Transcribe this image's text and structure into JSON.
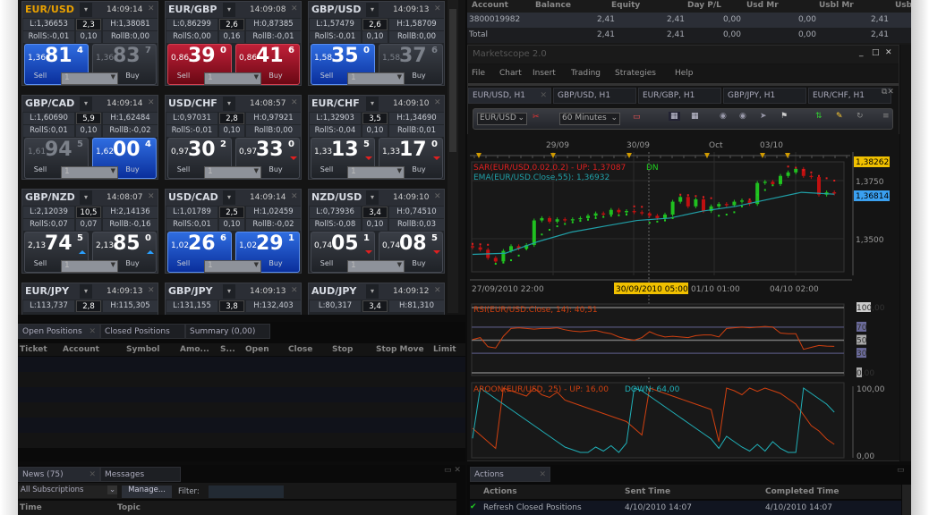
{
  "rates": [
    {
      "pair": "EUR/USD",
      "selected": true,
      "time": "14:09:14",
      "low": "L:1,36653",
      "spread": "2,3",
      "high": "H:1,38081",
      "rolls": "RollS:-0,01",
      "mid": "0,10",
      "rollb": "RollB:0,00",
      "sell": {
        "pre": "1,36",
        "big": "81",
        "pip": "4",
        "state": "blue",
        "arrow": ""
      },
      "buy": {
        "pre": "1,36",
        "big": "83",
        "pip": "7",
        "state": "dim",
        "arrow": ""
      },
      "amount": "1",
      "sell_label": "Sell",
      "buy_label": "Buy"
    },
    {
      "pair": "EUR/GBP",
      "time": "14:09:08",
      "low": "L:0,86299",
      "spread": "2,6",
      "high": "H:0,87385",
      "rolls": "RollS:0,00",
      "mid": "0,16",
      "rollb": "RollB:-0,01",
      "sell": {
        "pre": "0,86",
        "big": "39",
        "pip": "0",
        "state": "red",
        "arrow": ""
      },
      "buy": {
        "pre": "0,86",
        "big": "41",
        "pip": "6",
        "state": "red",
        "arrow": ""
      },
      "amount": "1",
      "sell_label": "Sell",
      "buy_label": "Buy"
    },
    {
      "pair": "GBP/USD",
      "time": "14:09:13",
      "low": "L:1,57479",
      "spread": "2,6",
      "high": "H:1,58709",
      "rolls": "RollS:-0,01",
      "mid": "0,10",
      "rollb": "RollB:0,00",
      "sell": {
        "pre": "1,58",
        "big": "35",
        "pip": "0",
        "state": "blue",
        "arrow": ""
      },
      "buy": {
        "pre": "1,58",
        "big": "37",
        "pip": "6",
        "state": "dim",
        "arrow": ""
      },
      "amount": "1",
      "sell_label": "Sell",
      "buy_label": "Buy"
    },
    {
      "pair": "GBP/CAD",
      "time": "14:09:14",
      "low": "L:1,60690",
      "spread": "5,9",
      "high": "H:1,62484",
      "rolls": "RollS:0,01",
      "mid": "0,10",
      "rollb": "RollB:-0,02",
      "sell": {
        "pre": "1,61",
        "big": "94",
        "pip": "5",
        "state": "dim",
        "arrow": ""
      },
      "buy": {
        "pre": "1,62",
        "big": "00",
        "pip": "4",
        "state": "blue",
        "arrow": ""
      },
      "amount": "1",
      "sell_label": "Sell",
      "buy_label": "Buy"
    },
    {
      "pair": "USD/CHF",
      "time": "14:08:57",
      "low": "L:0,97031",
      "spread": "2,8",
      "high": "H:0,97921",
      "rolls": "RollS:-0,01",
      "mid": "0,10",
      "rollb": "RollB:0,00",
      "sell": {
        "pre": "0,97",
        "big": "30",
        "pip": "2",
        "state": "normal",
        "arrow": ""
      },
      "buy": {
        "pre": "0,97",
        "big": "33",
        "pip": "0",
        "state": "normal",
        "arrow": "down"
      },
      "amount": "1",
      "sell_label": "Sell",
      "buy_label": "Buy"
    },
    {
      "pair": "EUR/CHF",
      "time": "14:09:10",
      "low": "L:1,32903",
      "spread": "3,5",
      "high": "H:1,34690",
      "rolls": "RollS:-0,04",
      "mid": "0,10",
      "rollb": "RollB:0,01",
      "sell": {
        "pre": "1,33",
        "big": "13",
        "pip": "5",
        "state": "normal",
        "arrow": "down"
      },
      "buy": {
        "pre": "1,33",
        "big": "17",
        "pip": "0",
        "state": "normal",
        "arrow": "down"
      },
      "amount": "1",
      "sell_label": "Sell",
      "buy_label": "Buy"
    },
    {
      "pair": "GBP/NZD",
      "time": "14:08:07",
      "low": "L:2,12039",
      "spread": "10,5",
      "high": "H:2,14136",
      "rolls": "RollS:0,07",
      "mid": "0,07",
      "rollb": "RollB:-0,16",
      "sell": {
        "pre": "2,13",
        "big": "74",
        "pip": "5",
        "state": "normal",
        "arrow": "up"
      },
      "buy": {
        "pre": "2,13",
        "big": "85",
        "pip": "0",
        "state": "normal",
        "arrow": "up"
      },
      "amount": "1",
      "sell_label": "Sell",
      "buy_label": "Buy"
    },
    {
      "pair": "USD/CAD",
      "time": "14:09:14",
      "low": "L:1,01789",
      "spread": "2,5",
      "high": "H:1,02459",
      "rolls": "RollS:0,01",
      "mid": "0,10",
      "rollb": "RollB:-0,02",
      "sell": {
        "pre": "1,02",
        "big": "26",
        "pip": "6",
        "state": "blue",
        "arrow": ""
      },
      "buy": {
        "pre": "1,02",
        "big": "29",
        "pip": "1",
        "state": "blue",
        "arrow": ""
      },
      "amount": "1",
      "sell_label": "Sell",
      "buy_label": "Buy"
    },
    {
      "pair": "NZD/USD",
      "time": "14:09:10",
      "low": "L:0,73936",
      "spread": "3,4",
      "high": "H:0,74510",
      "rolls": "RollS:-0,08",
      "mid": "0,10",
      "rollb": "RollB:0,03",
      "sell": {
        "pre": "0,74",
        "big": "05",
        "pip": "1",
        "state": "normal",
        "arrow": "down"
      },
      "buy": {
        "pre": "0,74",
        "big": "08",
        "pip": "5",
        "state": "normal",
        "arrow": "down"
      },
      "amount": "1",
      "sell_label": "Sell",
      "buy_label": "Buy"
    },
    {
      "pair": "EUR/JPY",
      "time": "14:09:13",
      "low": "L:113,737",
      "spread": "2,8",
      "high": "H:115,305"
    },
    {
      "pair": "GBP/JPY",
      "time": "14:09:13",
      "low": "L:131,155",
      "spread": "3,8",
      "high": "H:132,403"
    },
    {
      "pair": "AUD/JPY",
      "time": "14:09:12",
      "low": "L:80,317",
      "spread": "3,4",
      "high": "H:81,310"
    }
  ],
  "accounts": {
    "headers": [
      "Account",
      "Balance",
      "Equity",
      "Day P/L",
      "Usd Mr",
      "Usbl Mr",
      "Usb"
    ],
    "rows": [
      [
        "3800019982",
        "2,41",
        "2,41",
        "0,00",
        "0,00",
        "2,41"
      ],
      [
        "Total",
        "2,41",
        "2,41",
        "0,00",
        "0,00",
        "2,41"
      ]
    ]
  },
  "marketscope": {
    "title": "Marketscope 2.0",
    "menu": [
      "File",
      "Chart",
      "Insert",
      "Trading",
      "Strategies",
      "Help"
    ],
    "tabs": [
      "EUR/USD, H1",
      "GBP/USD, H1",
      "EUR/GBP, H1",
      "GBP/JPY, H1",
      "EUR/CHF, H1"
    ],
    "symbol": "EUR/USD",
    "timeframe": "60 Minutes",
    "sar_label": "SAR(EUR/USD,0.02,0.2) -  UP: 1,37087",
    "sar_dn": "DN",
    "ema_label": "EMA(EUR/USD.Close,55): 1,36932",
    "rsi_label": "RSI(EUR/USD.Close, 14): 40,51",
    "aroon_label": "AROON(EUR/USD, 25) -  UP: 16,00",
    "aroon_down": "DOWN: 64,00",
    "top_dates": [
      "29/09",
      "30/09",
      "Oct",
      "03/10"
    ],
    "bottom_dates": [
      "27/09/2010 22:00",
      "30/09/2010 05:00",
      "01/10 01:00",
      "04/10 02:00"
    ],
    "price_labels": [
      "1,3750",
      "1,3500"
    ],
    "high_marker": "1,38262",
    "current_marker": "1,36814",
    "rsi_axis": [
      "100,00",
      "70",
      "50",
      "30",
      "0,00"
    ],
    "aroon_axis": [
      "100,00",
      "0,00"
    ],
    "colors": {
      "up": "#20c020",
      "down": "#c01010",
      "ema": "#20a0a8",
      "sar_up": "#e02020",
      "sar_dn": "#20d020",
      "rsi": "#d04010",
      "aroon_up": "#d04010",
      "aroon_down": "#20b0b8",
      "marker_high": "#f0c000",
      "marker_current": "#3aa0f0"
    }
  },
  "chart_data": {
    "type": "line",
    "close": [
      1.3465,
      1.3455,
      1.342,
      1.3405,
      1.345,
      1.347,
      1.346,
      1.3475,
      1.358,
      1.359,
      1.3575,
      1.3585,
      1.358,
      1.3585,
      1.359,
      1.36,
      1.361,
      1.3605,
      1.3625,
      1.3615,
      1.362,
      1.3615,
      1.361,
      1.36,
      1.359,
      1.3605,
      1.366,
      1.368,
      1.364,
      1.367,
      1.362,
      1.364,
      1.365,
      1.3645,
      1.366,
      1.3665,
      1.365,
      1.374,
      1.3745,
      1.3735,
      1.377,
      1.3785,
      1.38,
      1.377,
      1.3765,
      1.369,
      1.37,
      1.3695
    ],
    "ema": [
      1.3435,
      1.344,
      1.349,
      1.353,
      1.3555,
      1.358,
      1.359,
      1.362,
      1.364,
      1.367,
      1.37,
      1.3692
    ],
    "sar": [
      1.348,
      1.3478,
      1.3476,
      1.3395,
      1.34,
      1.341,
      1.343,
      1.346,
      1.349,
      1.352,
      1.354,
      1.3555,
      1.3565,
      1.3572,
      1.3578,
      1.3583,
      1.359,
      1.3595,
      1.36,
      1.3602,
      1.3605,
      1.364,
      1.3638,
      1.357,
      1.3575,
      1.358,
      1.359,
      1.369,
      1.3688,
      1.3684,
      1.368,
      1.3675,
      1.36,
      1.3605,
      1.3615,
      1.364,
      1.367,
      1.369,
      1.371,
      1.373,
      1.3745,
      1.381,
      1.3805,
      1.3795,
      1.3785,
      1.377,
      1.376,
      1.375
    ],
    "rsi": [
      51,
      54,
      40,
      38,
      56,
      68,
      69,
      68,
      67,
      68,
      68,
      69,
      66,
      64,
      63,
      64,
      65,
      62,
      60,
      55,
      52,
      50,
      54,
      63,
      58,
      55,
      56,
      55,
      54,
      57,
      58,
      58,
      55,
      68,
      69,
      70,
      69,
      70,
      71,
      70,
      61,
      60,
      60,
      36,
      39,
      42,
      41,
      40.51
    ],
    "aroon_up": [
      40,
      30,
      20,
      10,
      100,
      96,
      92,
      88,
      100,
      90,
      86,
      94,
      82,
      78,
      74,
      70,
      66,
      62,
      58,
      54,
      50,
      40,
      30,
      100,
      96,
      92,
      88,
      84,
      80,
      76,
      72,
      68,
      20,
      100,
      96,
      90,
      100,
      95,
      100,
      96,
      92,
      84,
      76,
      60,
      44,
      36,
      24,
      16
    ],
    "aroon_down": [
      25,
      100,
      92,
      84,
      76,
      68,
      60,
      52,
      44,
      36,
      28,
      20,
      12,
      8,
      4,
      4,
      12,
      6,
      14,
      4,
      18,
      100,
      96,
      88,
      80,
      72,
      64,
      56,
      48,
      40,
      32,
      24,
      10,
      28,
      20,
      12,
      6,
      16,
      6,
      20,
      10,
      4,
      4,
      100,
      92,
      84,
      76,
      64
    ],
    "ylim": [
      1.3371,
      1.3833
    ]
  },
  "positions": {
    "tabs": [
      "Open Positions",
      "Closed Positions",
      "Summary (0,00)"
    ],
    "headers": [
      "Ticket",
      "Account",
      "Symbol",
      "Amo...",
      "S...",
      "Open",
      "Close",
      "Stop",
      "Stop Move",
      "Limit"
    ]
  },
  "news": {
    "tabs": [
      "News (75)",
      "Messages"
    ],
    "subscription": "All Subscriptions",
    "manage": "Manage...",
    "filter_label": "Filter:",
    "filter_value": "",
    "headers": [
      "Time",
      "Topic"
    ]
  },
  "actions": {
    "tab": "Actions",
    "headers": [
      "Actions",
      "Sent Time",
      "Completed Time"
    ],
    "rows": [
      {
        "action": "Refresh Closed Positions",
        "sent": "4/10/2010 14:07",
        "completed": "4/10/2010 14:07",
        "status": "check"
      }
    ]
  }
}
